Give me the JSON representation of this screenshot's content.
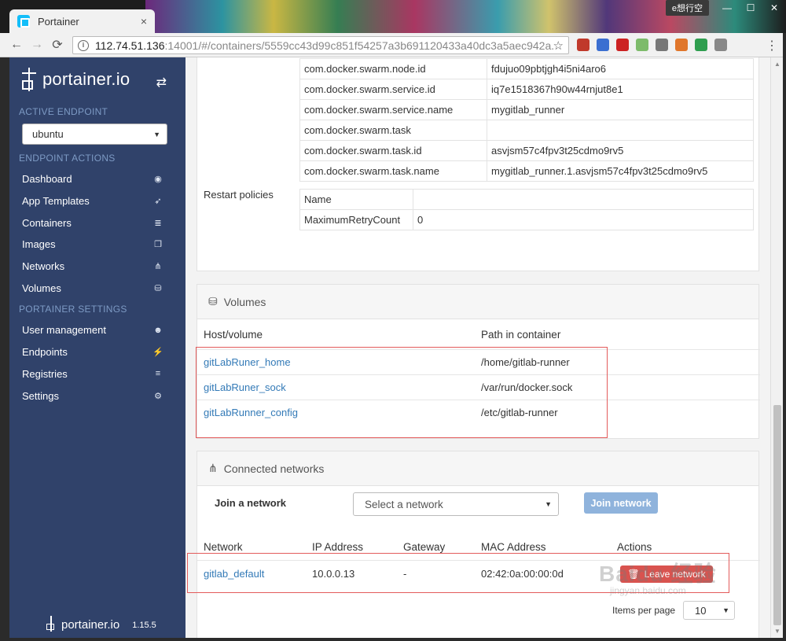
{
  "browser": {
    "tab_title": "Portainer",
    "tab_close": "×",
    "user_badge": "e想行空",
    "win_min": "—",
    "win_max": "☐",
    "win_close": "✕",
    "url_host": "112.74.51.136",
    "url_rest": ":14001/#/containers/5559cc43d99c851f54257a3b691120433a40dc3a5aec942a...",
    "back": "←",
    "forward": "→",
    "reload": "⟳",
    "star": "☆",
    "menu": "⋮",
    "ext_colors": [
      "#c0392b",
      "#3b6fd1",
      "#cc2222",
      "#7dbb6a",
      "#777777",
      "#e0762b",
      "#2f9e4f",
      "#888888"
    ]
  },
  "sidebar": {
    "brand": "portainer.io",
    "swap_icon": "⇄",
    "active_endpoint_title": "ACTIVE ENDPOINT",
    "endpoint_value": "ubuntu",
    "endpoint_actions_title": "ENDPOINT ACTIONS",
    "actions": [
      {
        "label": "Dashboard",
        "icon": "◉"
      },
      {
        "label": "App Templates",
        "icon": "➶"
      },
      {
        "label": "Containers",
        "icon": "≣"
      },
      {
        "label": "Images",
        "icon": "❐"
      },
      {
        "label": "Networks",
        "icon": "⋔"
      },
      {
        "label": "Volumes",
        "icon": "⛁"
      }
    ],
    "settings_title": "PORTAINER SETTINGS",
    "settings": [
      {
        "label": "User management",
        "icon": "☻"
      },
      {
        "label": "Endpoints",
        "icon": "⚡"
      },
      {
        "label": "Registries",
        "icon": "≡"
      },
      {
        "label": "Settings",
        "icon": "⚙"
      }
    ],
    "footer_brand": "portainer.io",
    "footer_version": "1.15.5"
  },
  "details": {
    "labels": [
      {
        "key": "com.docker.swarm.node.id",
        "value": "fdujuo09pbtjgh4i5ni4aro6"
      },
      {
        "key": "com.docker.swarm.service.id",
        "value": "iq7e1518367h90w44rnjut8e1"
      },
      {
        "key": "com.docker.swarm.service.name",
        "value": "mygitlab_runner"
      },
      {
        "key": "com.docker.swarm.task",
        "value": ""
      },
      {
        "key": "com.docker.swarm.task.id",
        "value": "asvjsm57c4fpv3t25cdmo9rv5"
      },
      {
        "key": "com.docker.swarm.task.name",
        "value": "mygitlab_runner.1.asvjsm57c4fpv3t25cdmo9rv5"
      }
    ],
    "restart_label": "Restart policies",
    "restart": [
      {
        "key": "Name",
        "value": ""
      },
      {
        "key": "MaximumRetryCount",
        "value": "0"
      }
    ]
  },
  "volumes": {
    "title": "Volumes",
    "col_host": "Host/volume",
    "col_path": "Path in container",
    "rows": [
      {
        "host": "gitLabRuner_home",
        "path": "/home/gitlab-runner"
      },
      {
        "host": "gitLabRuner_sock",
        "path": "/var/run/docker.sock"
      },
      {
        "host": "gitLabRunner_config",
        "path": "/etc/gitlab-runner"
      }
    ]
  },
  "networks": {
    "title": "Connected networks",
    "join_label": "Join a network",
    "select_placeholder": "Select a network",
    "join_button": "Join network",
    "col_network": "Network",
    "col_ip": "IP Address",
    "col_gateway": "Gateway",
    "col_mac": "MAC Address",
    "col_actions": "Actions",
    "rows": [
      {
        "network": "gitlab_default",
        "ip": "10.0.0.13",
        "gateway": "-",
        "mac": "02:42:0a:00:00:0d",
        "action": "Leave network"
      }
    ],
    "items_per_page_label": "Items per page",
    "items_per_page": "10"
  },
  "watermark": {
    "main": "Baidu 经验",
    "sub": "jingyan.baidu.com"
  },
  "highlight_color": "#e35b5b"
}
